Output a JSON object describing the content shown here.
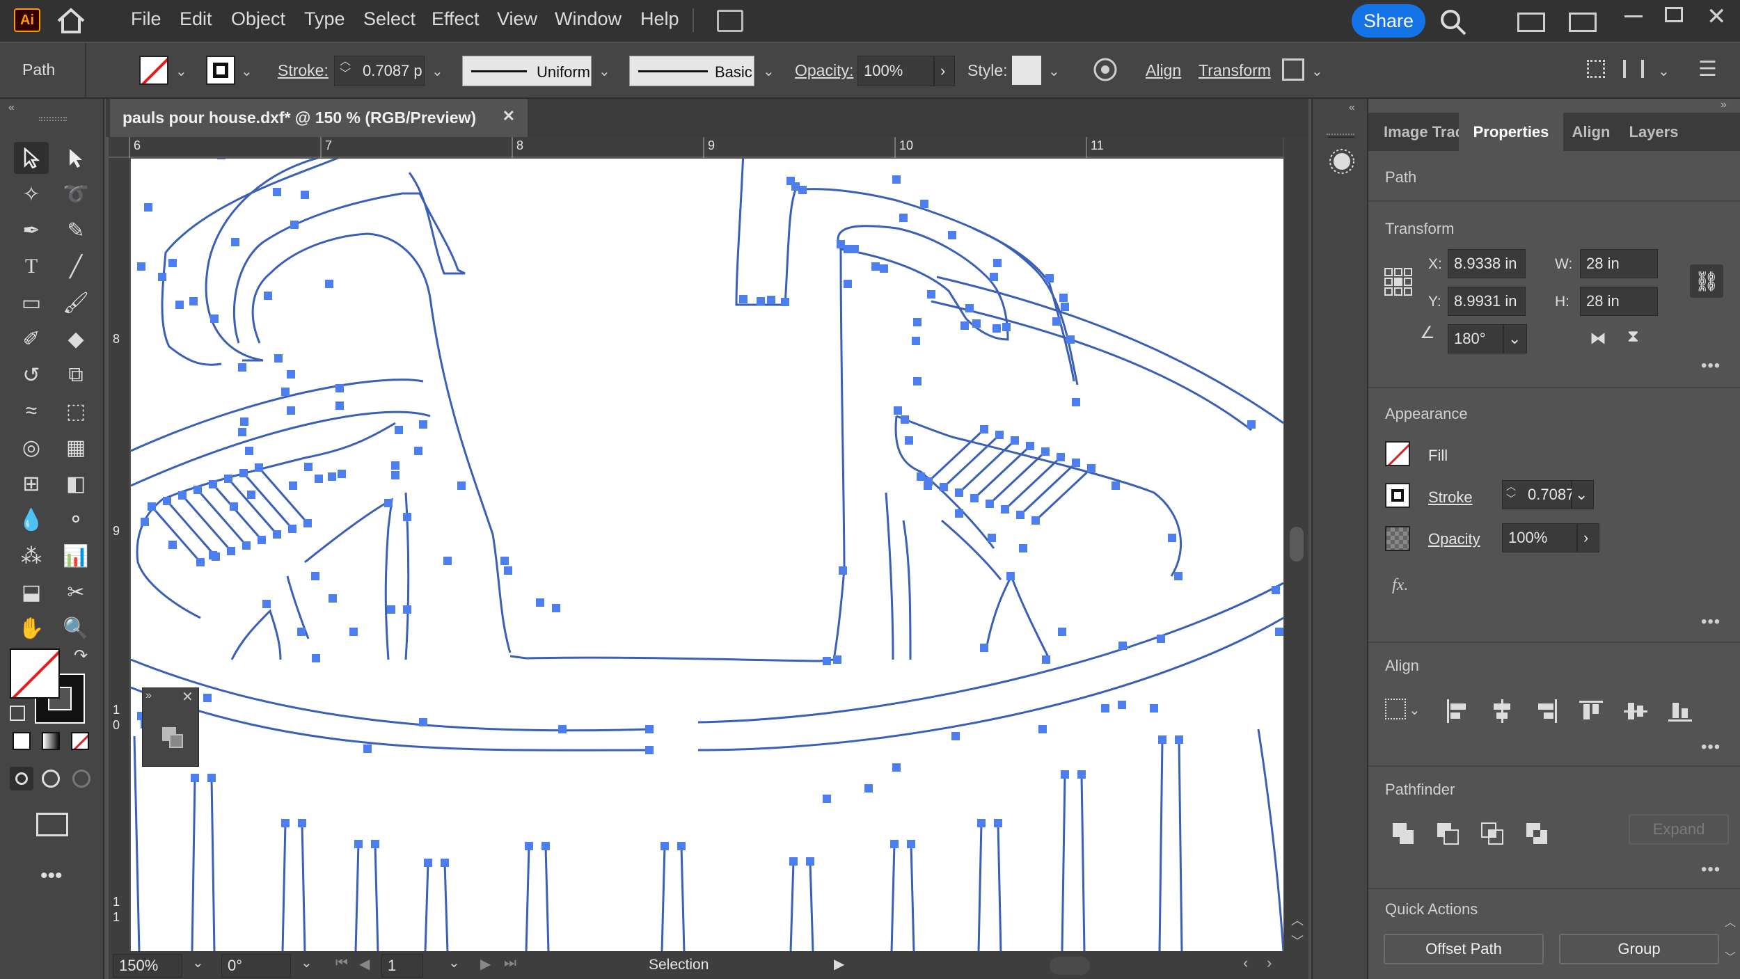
{
  "app": {
    "logo": "Ai"
  },
  "menu": [
    "File",
    "Edit",
    "Object",
    "Type",
    "Select",
    "Effect",
    "View",
    "Window",
    "Help"
  ],
  "share_label": "Share",
  "control": {
    "selection_type": "Path",
    "stroke_label": "Stroke:",
    "stroke_value": "0.7087 p",
    "profile_label": "Uniform",
    "brush_label": "Basic",
    "opacity_label": "Opacity:",
    "opacity_value": "100%",
    "style_label": "Style:",
    "align_label": "Align",
    "transform_label": "Transform"
  },
  "document": {
    "tab_title": "pauls pour house.dxf* @ 150 % (RGB/Preview)",
    "ruler_top": [
      "6",
      "7",
      "8",
      "9",
      "10",
      "11"
    ],
    "ruler_left": [
      "8",
      "9",
      "1\n0",
      "1\n1"
    ],
    "path_color": "#3a5fb6",
    "anchor_color": "#4d7ef0"
  },
  "status": {
    "zoom": "150%",
    "rotation": "0°",
    "artboard": "1",
    "tool": "Selection"
  },
  "panel": {
    "tabs": [
      "Image Trac",
      "Properties",
      "Align",
      "Layers"
    ],
    "active_tab": "Properties",
    "object_type": "Path",
    "transform": {
      "title": "Transform",
      "x_label": "X:",
      "x": "8.9338 in",
      "y_label": "Y:",
      "y": "8.9931 in",
      "w_label": "W:",
      "w": "28 in",
      "h_label": "H:",
      "h": "28 in",
      "angle": "180°"
    },
    "appearance": {
      "title": "Appearance",
      "fill_label": "Fill",
      "stroke_label": "Stroke",
      "stroke_value": "0.7087",
      "opacity_label": "Opacity",
      "opacity_value": "100%",
      "fx_label": "fx."
    },
    "align": {
      "title": "Align"
    },
    "pathfinder": {
      "title": "Pathfinder",
      "expand_label": "Expand"
    },
    "quick_actions": {
      "title": "Quick Actions",
      "offset_label": "Offset Path",
      "group_label": "Group"
    }
  }
}
